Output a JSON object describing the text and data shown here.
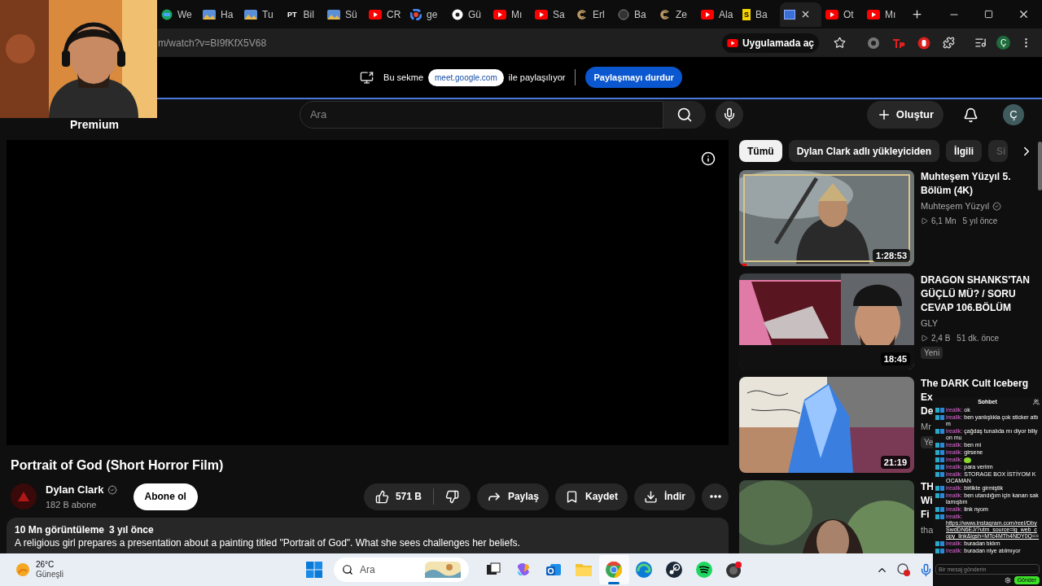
{
  "browser": {
    "tabs": [
      {
        "label": "We",
        "kind": "globe",
        "selected": false
      },
      {
        "label": "Ha",
        "selected": false
      },
      {
        "label": "Tu",
        "selected": false
      },
      {
        "label": "Bil",
        "kind": "glyph",
        "glyph": "PT",
        "selected": false
      },
      {
        "label": "Sü",
        "selected": false
      },
      {
        "label": "CR",
        "kind": "youtube",
        "selected": false
      },
      {
        "label": "ge",
        "kind": "google",
        "selected": false
      },
      {
        "label": "Gü",
        "kind": "circle",
        "selected": false
      },
      {
        "label": "Mı",
        "kind": "youtube",
        "selected": false
      },
      {
        "label": "Sa",
        "kind": "youtube",
        "selected": false
      },
      {
        "label": "Erl",
        "kind": "swirl",
        "selected": false
      },
      {
        "label": "Ba",
        "kind": "dark",
        "selected": false
      },
      {
        "label": "Ze",
        "kind": "swirl",
        "selected": false
      },
      {
        "label": "Ala",
        "kind": "youtube",
        "selected": false
      },
      {
        "label": "Ba",
        "kind": "glyph",
        "glyph": "S",
        "selected": false
      },
      {
        "kind": "screen",
        "selected": true
      },
      {
        "label": "Ot",
        "kind": "youtube",
        "selected": false
      },
      {
        "label": "Mı",
        "kind": "youtube",
        "selected": false
      }
    ],
    "address": "m/watch?v=BI9fKfX5V68",
    "open_in_app": "Uygulamada aç",
    "profile": "Ç"
  },
  "share_bar": {
    "prefix": "Bu sekme",
    "site": "meet.google.com",
    "suffix": "ile paylaşılıyor",
    "stop_button": "Paylaşmayı durdur"
  },
  "youtube": {
    "logo": "Premium",
    "search_placeholder": "Ara",
    "create_button": "Oluştur",
    "avatar": "Ç",
    "video": {
      "title": "Portrait of God (Short Horror Film)",
      "channel": "Dylan Clark",
      "verified": true,
      "subscribers": "182 B abone",
      "subscribe": "Abone ol",
      "likes": "571 B",
      "share": "Paylaş",
      "save": "Kaydet",
      "download": "İndir",
      "views": "10 Mn görüntüleme",
      "age": "3 yıl önce",
      "description": "A religious girl prepares a presentation about a painting titled \"Portrait of God\". What she sees challenges her beliefs."
    },
    "chips": [
      {
        "label": "Tümü",
        "selected": true
      },
      {
        "label": "Dylan Clark adlı yükleyiciden",
        "selected": false
      },
      {
        "label": "İlgili",
        "selected": false
      },
      {
        "label": "Si",
        "selected": false
      }
    ],
    "recommendations": [
      {
        "title_lines": [
          "Muhteşem Yüzyıl 5.",
          "Bölüm (4K)"
        ],
        "channel": "Muhteşem Yüzyıl",
        "verified": true,
        "views": "6,1 Mn",
        "age": "5 yıl önce",
        "duration": "1:28:53",
        "level": 0.04,
        "kind": "warrior"
      },
      {
        "title_lines": [
          "DRAGON SHANKS'TAN",
          "GÜÇLÜ MÜ? / SORU",
          "CEVAP 106.BÖLÜM"
        ],
        "channel": "GLY",
        "views": "2,4 B",
        "age": "51 dk. önce",
        "badge": "Yeni",
        "duration": "18:45",
        "kind": "split"
      },
      {
        "title_lines": [
          "The DARK Cult Iceberg",
          "Ex",
          "De"
        ],
        "channel": "Mr",
        "badge": "Ye",
        "duration": "21:19",
        "kind": "iceberg"
      },
      {
        "title_lines": [
          "TH",
          "Wi",
          "Fi"
        ],
        "channel": "tha",
        "kind": "forest"
      }
    ]
  },
  "taskbar": {
    "temperature": "26°C",
    "weather": "Güneşli",
    "search_placeholder": "Ara",
    "apps": [
      {
        "kind": "taskview",
        "selected": false
      },
      {
        "kind": "copilot",
        "selected": false
      },
      {
        "kind": "mail",
        "selected": false
      },
      {
        "kind": "folder",
        "selected": false
      },
      {
        "kind": "chrome",
        "selected": true
      },
      {
        "kind": "edge",
        "selected": false
      },
      {
        "kind": "steam",
        "selected": false
      },
      {
        "kind": "spotify",
        "selected": false
      },
      {
        "kind": "record",
        "selected": false
      }
    ]
  },
  "chat": {
    "title": "Sohbet",
    "messages": [
      {
        "user": "irealik:",
        "kind": "text",
        "text": "ok"
      },
      {
        "user": "irealik:",
        "kind": "text",
        "text": "ben yanlışlıkla çok sticker attım"
      },
      {
        "user": "irealik:",
        "kind": "text",
        "text": "çağdaş tunalıda mı diyor biliyon mu"
      },
      {
        "user": "irealik:",
        "kind": "text",
        "text": "ben mi"
      },
      {
        "user": "irealik:",
        "kind": "text",
        "text": "girsene"
      },
      {
        "user": "irealik:",
        "kind": "sticker"
      },
      {
        "user": "irealik:",
        "kind": "text",
        "text": "para verirm"
      },
      {
        "user": "irealik:",
        "kind": "text",
        "text": "STORAGE BOX İSTİYOM KOCAMAN"
      },
      {
        "user": "irealik:",
        "kind": "text",
        "text": "birlikte girmiştik"
      },
      {
        "user": "irealik:",
        "kind": "text",
        "text": "ben utandığım için kanarı saklamıştım"
      },
      {
        "user": "irealik:",
        "kind": "text",
        "text": "link nyom"
      },
      {
        "user": "irealik:",
        "kind": "link",
        "text": "https://www.instagram.com/reel/DbySwdDN6EJ/?utm_source=ig_web_copy_link&igsh=MTc4MTh4NDY0Q=="
      },
      {
        "user": "irealik:",
        "kind": "text",
        "text": "buradan tıklım"
      },
      {
        "user": "irealik:",
        "kind": "text",
        "text": "buradan niye atılmıyor"
      }
    ],
    "input_placeholder": "Bir mesaj gönderin",
    "send": "Gönder"
  }
}
